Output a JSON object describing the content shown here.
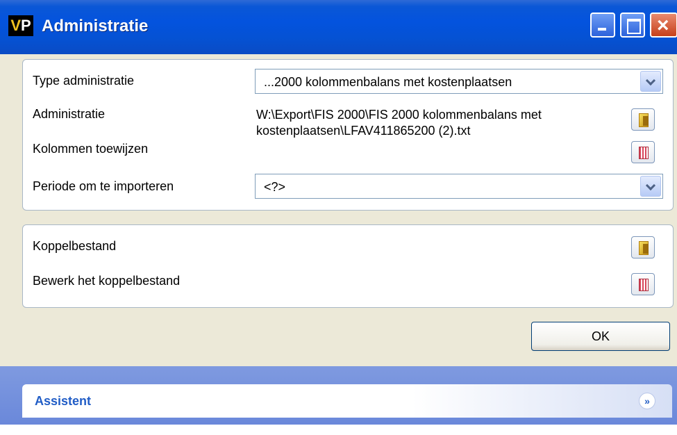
{
  "window": {
    "logo": "VP",
    "title": "Administratie"
  },
  "form": {
    "type_label": "Type administratie",
    "type_value": "...2000 kolommenbalans met kostenplaatsen",
    "admin_label": "Administratie",
    "admin_path": "W:\\Export\\FIS 2000\\FIS 2000 kolommenbalans met kostenplaatsen\\LFAV411865200 (2).txt",
    "kolommen_label": "Kolommen toewijzen",
    "periode_label": "Periode om te importeren",
    "periode_value": "<?>"
  },
  "koppel": {
    "koppelbestand_label": "Koppelbestand",
    "bewerk_label": "Bewerk het koppelbestand"
  },
  "buttons": {
    "ok_label": "OK"
  },
  "assistant": {
    "title": "Assistent",
    "chevron": "»"
  },
  "icons": {
    "open": "folder-open-icon",
    "edit": "edit-columns-icon"
  }
}
